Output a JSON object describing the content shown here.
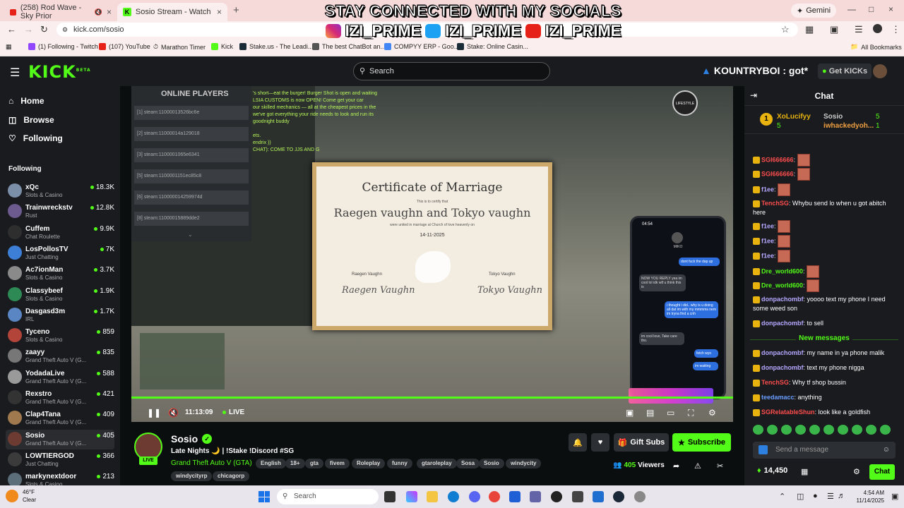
{
  "browser": {
    "tabs": [
      {
        "label": "(258) Rod Wave - Sky Prior",
        "icon": "youtube-icon"
      },
      {
        "label": "Sosio Stream - Watch Live on K",
        "icon": "kick-icon"
      }
    ],
    "url": "kick.com/sosio",
    "gemini_label": "Gemini",
    "bookmarks": [
      "(1) Following - Twitch",
      "(107) YouTube",
      "Marathon Timer",
      "Kick",
      "Stake.us - The Leadi...",
      "The best ChatBot an...",
      "COMPYY ERP - Goo...",
      "Stake: Online Casin..."
    ],
    "all_bookmarks": "All Bookmarks"
  },
  "overlay": {
    "title": "STAY CONNECTED WITH MY SOCIALS",
    "handles": [
      "IZI_PRIME",
      "IZI_PRIME",
      "IZI_PRIME"
    ]
  },
  "header": {
    "logo": "KICK",
    "logo_tag": "BETA",
    "search_placeholder": "Search",
    "promo_text": "KOUNTRYBOI : got*",
    "get_kicks": "Get KICKs"
  },
  "sidebar": {
    "nav": [
      {
        "label": "Home",
        "icon": "home-icon"
      },
      {
        "label": "Browse",
        "icon": "browse-icon"
      },
      {
        "label": "Following",
        "icon": "heart-icon"
      }
    ],
    "following_heading": "Following",
    "channels": [
      {
        "name": "xQc",
        "category": "Slots & Casino",
        "viewers": "18.3K",
        "color": "#7b8fa8"
      },
      {
        "name": "Trainwreckstv",
        "category": "Rust",
        "viewers": "12.8K",
        "color": "#6d5a8f"
      },
      {
        "name": "Cuffem",
        "category": "Chat Roulette",
        "viewers": "9.9K",
        "color": "#2e2e2e"
      },
      {
        "name": "LosPollosTV",
        "category": "Just Chatting",
        "viewers": "7K",
        "color": "#3d7fd6"
      },
      {
        "name": "Ac7ionMan",
        "category": "Slots & Casino",
        "viewers": "3.7K",
        "color": "#8a8a8a"
      },
      {
        "name": "Classybeef",
        "category": "Slots & Casino",
        "viewers": "1.9K",
        "color": "#2d8a55"
      },
      {
        "name": "Dasgasd3m",
        "category": "IRL",
        "viewers": "1.7K",
        "color": "#5a86c4"
      },
      {
        "name": "Tyceno",
        "category": "Slots & Casino",
        "viewers": "859",
        "color": "#b2443a"
      },
      {
        "name": "zaayy",
        "category": "Grand Theft Auto V (G...",
        "viewers": "835",
        "color": "#777"
      },
      {
        "name": "YodadaLive",
        "category": "Grand Theft Auto V (G...",
        "viewers": "588",
        "color": "#9a9a9a"
      },
      {
        "name": "Rexstro",
        "category": "Grand Theft Auto V (G...",
        "viewers": "421",
        "color": "#333"
      },
      {
        "name": "Clap4Tana",
        "category": "Grand Theft Auto V (G...",
        "viewers": "409",
        "color": "#a07a4e"
      },
      {
        "name": "Sosio",
        "category": "Grand Theft Auto V (G...",
        "viewers": "405",
        "color": "#6e3b32",
        "selected": true
      },
      {
        "name": "LOWTIERGOD",
        "category": "Just Chatting",
        "viewers": "366",
        "color": "#3b3b3b"
      },
      {
        "name": "markynextdoor",
        "category": "Slots & Casino",
        "viewers": "213",
        "color": "#5b6e7a"
      }
    ]
  },
  "video": {
    "online_players_title": "ONLINE PLAYERS",
    "players": [
      "[1] steam:11000013526bc6e",
      "[2] steam:11000014a129018",
      "[3] steam:1100001065e6341",
      "[5] steam:1100001151ec85c8",
      "[6] steam:110000014259974d",
      "[8] steam:11000015889dde2"
    ],
    "ingame_chat": [
      "'s short—eat the burger! Burger Shot is open and waiting",
      "LSIA CUSTOMS is now OPEN! Come get your car",
      "our skilled mechanics — all at the cheapest prices in the",
      "we've got everything your ride needs to look and run its",
      "goodnight buddy",
      "ets.",
      "endrix ))",
      "CHAT): COME TO JJS AND G"
    ],
    "lifestyle_badge": "LIFESTYLE",
    "certificate": {
      "title": "Certificate of Marriage",
      "subtitle": "This is to certify that",
      "names": "Raegen vaughn and Tokyo vaughn",
      "united": "were united in marriage at Church of love heavenly on",
      "date": "14-11-2025",
      "left_label": "Raegen Vaughn",
      "left_sig": "Raegen Vaughn",
      "right_label": "Tokyo Vaughn",
      "right_sig": "Tokyo Vaughn"
    },
    "phone": {
      "time": "04:54",
      "contact": "MIKO",
      "messages": [
        {
          "text": "dont fuck the dap up",
          "side": "b"
        },
        {
          "text": "NOW YOU REPLY yea im cool lol idk wtf u think this is",
          "side": "g"
        },
        {
          "text": "i thought i did.. why is u doing all dat im with my mmmms nem im tryna find a cnh",
          "side": "b"
        },
        {
          "text": "im cool love, Take care tho.",
          "side": "g"
        },
        {
          "text": "fetch wyo",
          "side": "b"
        },
        {
          "text": "im waiting",
          "side": "b"
        }
      ]
    },
    "timecode": "11:13:09",
    "live_label": "LIVE"
  },
  "stream": {
    "name": "Sosio",
    "live_badge": "LIVE",
    "title": "Late Nights 🌙 | !Stake !Discord #SG",
    "game": "Grand Theft Auto V (GTA)",
    "tags": [
      "English",
      "18+",
      "gta",
      "fivem",
      "Roleplay",
      "funny",
      "gtaroleplay",
      "Sosa",
      "Sosio",
      "windycity",
      "windycityrp",
      "chicagorp"
    ],
    "gift_subs": "Gift Subs",
    "subscribe": "Subscribe",
    "viewers": "405",
    "viewers_label": "Viewers"
  },
  "chat": {
    "title": "Chat",
    "leaderboard": [
      {
        "rank": "1",
        "name": "XoLucifyy",
        "count": "5"
      },
      {
        "name": "Sosio",
        "count": "5"
      },
      {
        "name": "iwhackedyoh...",
        "count": "1"
      }
    ],
    "messages": [
      {
        "user": "SGI666666",
        "text": "",
        "color": "#ff4d4d",
        "emote": true
      },
      {
        "user": "SGI666666",
        "text": "",
        "color": "#ff4d4d",
        "emote": true
      },
      {
        "user": "f1ee",
        "text": "",
        "color": "#b7a7ff",
        "emote": true
      },
      {
        "user": "TenchSG",
        "text": "Whybu send lo when u got abitch here",
        "color": "#ff4d4d"
      },
      {
        "user": "f1ee",
        "text": "",
        "color": "#b7a7ff",
        "emote": true
      },
      {
        "user": "f1ee",
        "text": "",
        "color": "#b7a7ff",
        "emote": true
      },
      {
        "user": "f1ee",
        "text": "",
        "color": "#b7a7ff",
        "emote": true
      },
      {
        "user": "Dre_world600",
        "text": "",
        "color": "#53fc18",
        "emote": true
      },
      {
        "user": "Dre_world600",
        "text": "",
        "color": "#53fc18",
        "emote": true
      },
      {
        "user": "donpachombf",
        "text": "yoooo text my phone I need some weed son",
        "color": "#b7a7ff"
      },
      {
        "user": "donpachombf",
        "text": "to sell",
        "color": "#b7a7ff"
      }
    ],
    "new_messages_label": "New messages",
    "new_messages": [
      {
        "user": "donpachombf",
        "text": "my name in ya phone malik",
        "color": "#b7a7ff"
      },
      {
        "user": "donpachombf",
        "text": "text my phone nigga",
        "color": "#b7a7ff"
      },
      {
        "user": "TenchSG",
        "text": "Why tf shop bussin",
        "color": "#ff4d4d"
      },
      {
        "user": "teedamacc",
        "text": "anything",
        "color": "#6b9dff"
      },
      {
        "user": "SGRelatableShun",
        "text": "look like a goldfish",
        "color": "#ff4d4d"
      }
    ],
    "input_placeholder": "Send a message",
    "kicks_balance": "14,450",
    "send_label": "Chat"
  },
  "taskbar": {
    "temp": "46°F",
    "condition": "Clear",
    "search": "Search",
    "time": "4:54 AM",
    "date": "11/14/2025"
  }
}
